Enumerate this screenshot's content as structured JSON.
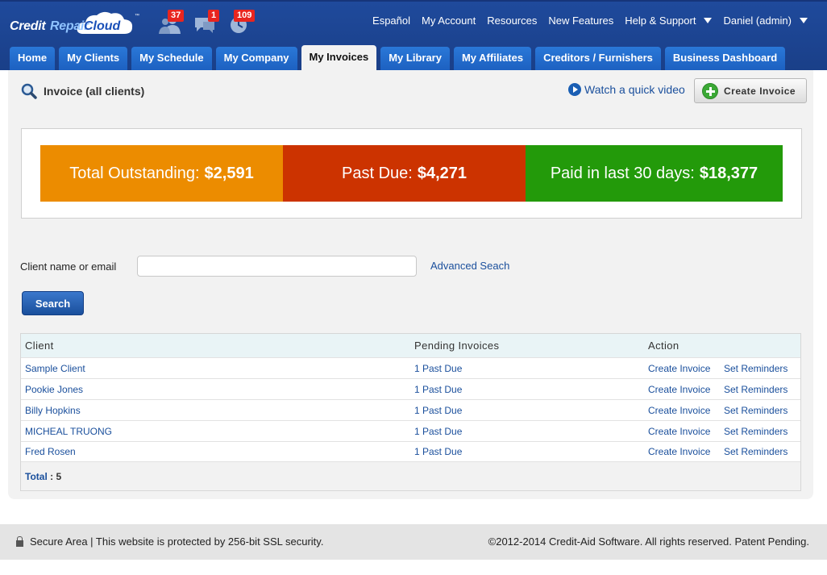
{
  "brand": {
    "part1": "Credit",
    "part2": "Repair",
    "part3": "Cloud",
    "tm": "™"
  },
  "notifications": [
    {
      "icon": "users-icon",
      "count": "37"
    },
    {
      "icon": "chat-icon",
      "count": "1"
    },
    {
      "icon": "clock-icon",
      "count": "109"
    }
  ],
  "topnav": {
    "espanol": "Español",
    "account": "My Account",
    "resources": "Resources",
    "features": "New Features",
    "help": "Help & Support",
    "user": "Daniel (admin)"
  },
  "tabs": [
    "Home",
    "My Clients",
    "My Schedule",
    "My Company",
    "My Invoices",
    "My Library",
    "My Affiliates",
    "Creditors / Furnishers",
    "Business Dashboard"
  ],
  "active_tab": "My Invoices",
  "page": {
    "title": "Invoice (all clients)",
    "video_link": "Watch a quick video",
    "create_button": "Create Invoice"
  },
  "summary": {
    "outstanding": {
      "label": "Total Outstanding:",
      "value": "$2,591",
      "color": "#ec8c00"
    },
    "past_due": {
      "label": "Past Due:",
      "value": "$4,271",
      "color": "#cc3300"
    },
    "paid": {
      "label": "Paid in last 30 days:",
      "value": "$18,377",
      "color": "#239a0a"
    }
  },
  "search": {
    "label": "Client name or email",
    "value": "",
    "placeholder": "",
    "advanced_link": "Advanced Seach",
    "button": "Search"
  },
  "table": {
    "headers": {
      "client": "Client",
      "pending": "Pending Invoices",
      "action": "Action"
    },
    "rows": [
      {
        "client": "Sample Client",
        "pending": "1 Past Due",
        "create": "Create Invoice",
        "remind": "Set Reminders"
      },
      {
        "client": "Pookie Jones",
        "pending": "1 Past Due",
        "create": "Create Invoice",
        "remind": "Set Reminders"
      },
      {
        "client": "Billy Hopkins",
        "pending": "1 Past Due",
        "create": "Create Invoice",
        "remind": "Set Reminders"
      },
      {
        "client": "MICHEAL TRUONG",
        "pending": "1 Past Due",
        "create": "Create Invoice",
        "remind": "Set Reminders"
      },
      {
        "client": "Fred Rosen",
        "pending": "1 Past Due",
        "create": "Create Invoice",
        "remind": "Set Reminders"
      }
    ],
    "total_label": "Total",
    "total_sep": " : ",
    "total_value": "5"
  },
  "footer": {
    "secure": "Secure Area | This website is protected by 256-bit SSL security.",
    "copyright": "©2012-2014 Credit-Aid Software. All rights reserved. Patent Pending."
  }
}
